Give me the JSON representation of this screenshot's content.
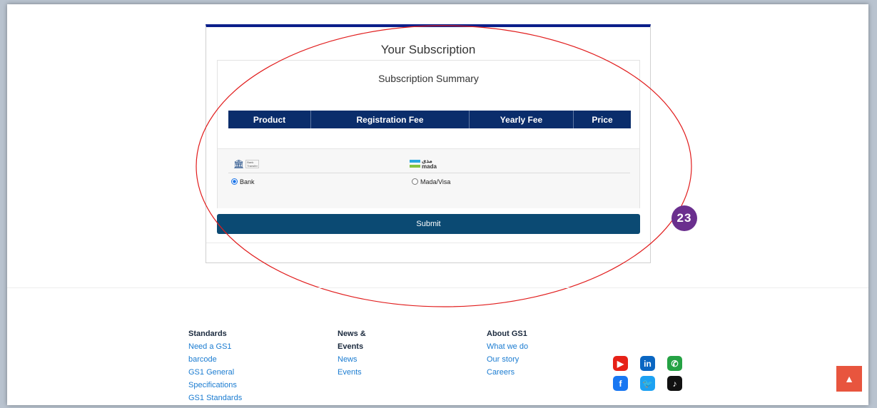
{
  "card": {
    "title": "Your Subscription",
    "summary_title": "Subscription Summary",
    "table_headers": [
      "Product",
      "Registration Fee",
      "Yearly Fee",
      "Price"
    ]
  },
  "payment": {
    "bank_logo_text": "Bank Transfer",
    "mada_logo_ar": "مدى",
    "mada_logo_en": "mada",
    "options": [
      {
        "label": "Bank",
        "checked": true
      },
      {
        "label": "Mada/Visa",
        "checked": false
      }
    ]
  },
  "submit_label": "Submit",
  "annotation": {
    "badge": "23",
    "ellipse_color": "#e11d1d",
    "badge_color": "#6a2f8e"
  },
  "footer": {
    "columns": [
      {
        "heading": "Standards",
        "links": [
          "Need a GS1",
          "barcode",
          "GS1 General",
          "Specifications",
          "GS1 Standards"
        ]
      },
      {
        "heading": [
          "News &",
          "Events"
        ],
        "links": [
          "News",
          "Events"
        ]
      },
      {
        "heading": "About GS1",
        "links": [
          "What we do",
          "Our story",
          "Careers"
        ]
      }
    ],
    "social": [
      {
        "name": "youtube",
        "glyph": "▶",
        "color": "#e62117"
      },
      {
        "name": "linkedin",
        "glyph": "in",
        "color": "#0a66c2"
      },
      {
        "name": "whatsapp",
        "glyph": "✆",
        "color": "#25a244"
      },
      {
        "name": "facebook",
        "glyph": "f",
        "color": "#1877f2"
      },
      {
        "name": "twitter",
        "glyph": "🐦",
        "color": "#1da1f2"
      },
      {
        "name": "tiktok",
        "glyph": "♪",
        "color": "#111111"
      }
    ],
    "scroll_top_icon": "chevron-up-icon",
    "scroll_top_glyph": "▲"
  }
}
